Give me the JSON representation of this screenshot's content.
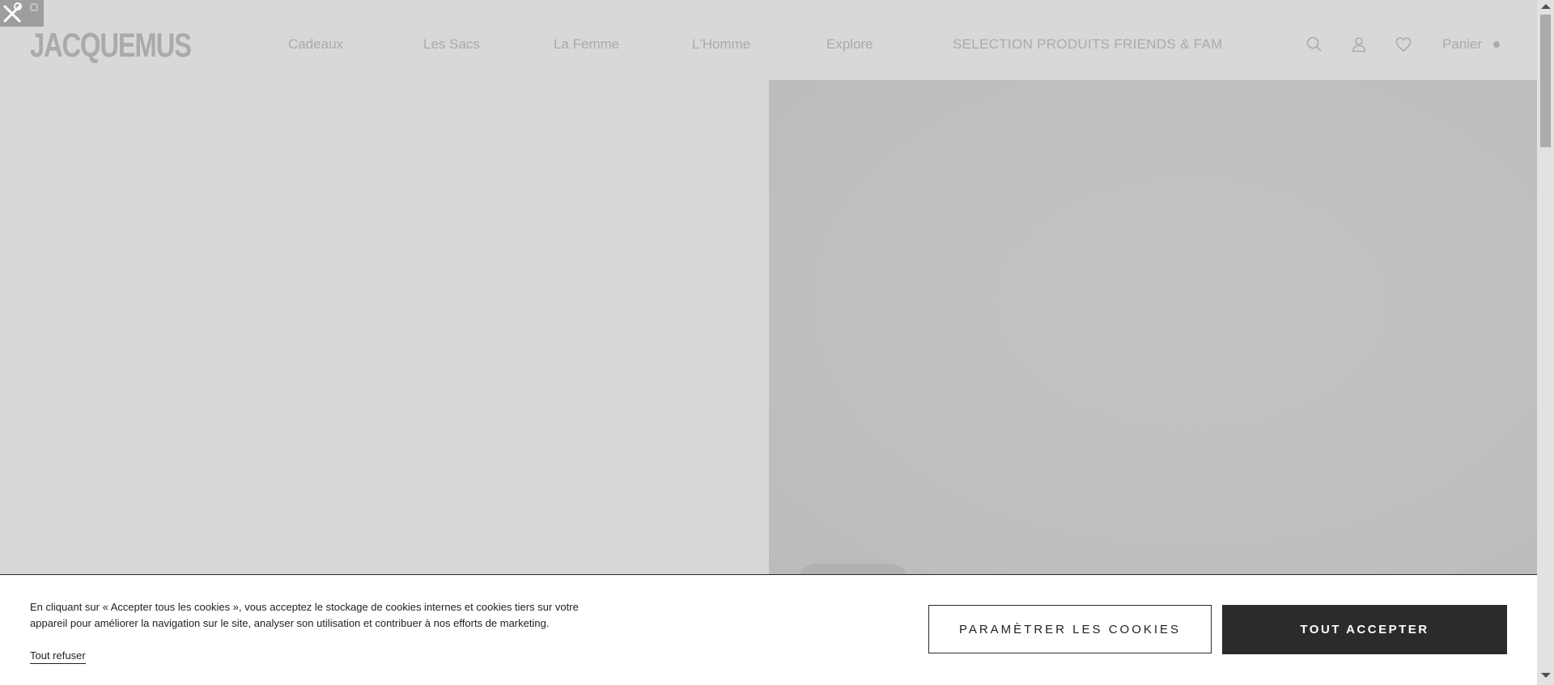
{
  "header": {
    "logo": "JACQUEMUS",
    "nav": [
      {
        "label": "Cadeaux"
      },
      {
        "label": "Les Sacs"
      },
      {
        "label": "La Femme"
      },
      {
        "label": "L'Homme"
      },
      {
        "label": "Explore"
      },
      {
        "label": "SELECTION PRODUITS FRIENDS & FAM"
      }
    ],
    "cart_label": "Panier"
  },
  "cookie_banner": {
    "text": "En cliquant sur « Accepter tous les cookies », vous acceptez le stockage de cookies internes et cookies tiers sur votre appareil pour améliorer la navigation sur le site, analyser son utilisation et contribuer à nos efforts de marketing.",
    "refuse_label": "Tout refuser",
    "settings_label": "PARAMÈTRER LES COOKIES",
    "accept_label": "TOUT ACCEPTER"
  },
  "icons": {
    "search": "search-icon",
    "account": "user-icon",
    "wishlist": "heart-icon",
    "tools": "tools-icon"
  },
  "colors": {
    "overlay_gray": "#d8d8d8",
    "dim_text": "#aaaaaa",
    "accept_bg": "#2b2b2b"
  }
}
